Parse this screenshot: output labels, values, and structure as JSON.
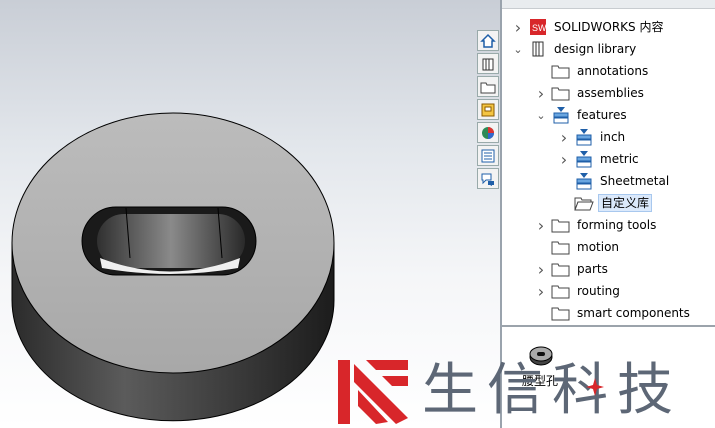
{
  "viewport": {
    "model": "slotted-disc-part"
  },
  "tabs": [
    {
      "name": "home-icon"
    },
    {
      "name": "parts-icon"
    },
    {
      "name": "folder-icon"
    },
    {
      "name": "appearance-icon"
    },
    {
      "name": "color-wheel-icon"
    },
    {
      "name": "properties-list-icon"
    },
    {
      "name": "forum-icon"
    }
  ],
  "tree": [
    {
      "label": "SOLIDWORKS 内容",
      "indent": 0,
      "expander": ">",
      "icon": "solidworks-icon"
    },
    {
      "label": "design library",
      "indent": 0,
      "expander": "v",
      "icon": "library-icon"
    },
    {
      "label": "annotations",
      "indent": 1,
      "expander": "",
      "icon": "folder-icon"
    },
    {
      "label": "assemblies",
      "indent": 1,
      "expander": ">",
      "icon": "folder-icon"
    },
    {
      "label": "features",
      "indent": 1,
      "expander": "v",
      "icon": "feature-icon"
    },
    {
      "label": "inch",
      "indent": 2,
      "expander": ">",
      "icon": "feature-icon"
    },
    {
      "label": "metric",
      "indent": 2,
      "expander": ">",
      "icon": "feature-icon"
    },
    {
      "label": "Sheetmetal",
      "indent": 2,
      "expander": "",
      "icon": "feature-icon"
    },
    {
      "label": "自定义库",
      "indent": 2,
      "expander": "",
      "icon": "folder-open-icon",
      "selected": true
    },
    {
      "label": "forming tools",
      "indent": 1,
      "expander": ">",
      "icon": "folder-icon"
    },
    {
      "label": "motion",
      "indent": 1,
      "expander": "",
      "icon": "folder-icon"
    },
    {
      "label": "parts",
      "indent": 1,
      "expander": ">",
      "icon": "folder-icon"
    },
    {
      "label": "routing",
      "indent": 1,
      "expander": ">",
      "icon": "folder-icon"
    },
    {
      "label": "smart components",
      "indent": 1,
      "expander": "",
      "icon": "folder-icon"
    }
  ],
  "preview": {
    "label": "腰型孔",
    "icon": "feature-part-icon"
  },
  "watermark": {
    "text": "生信科技",
    "logo": "brand-logo-icon",
    "accent": "#d8262a"
  }
}
